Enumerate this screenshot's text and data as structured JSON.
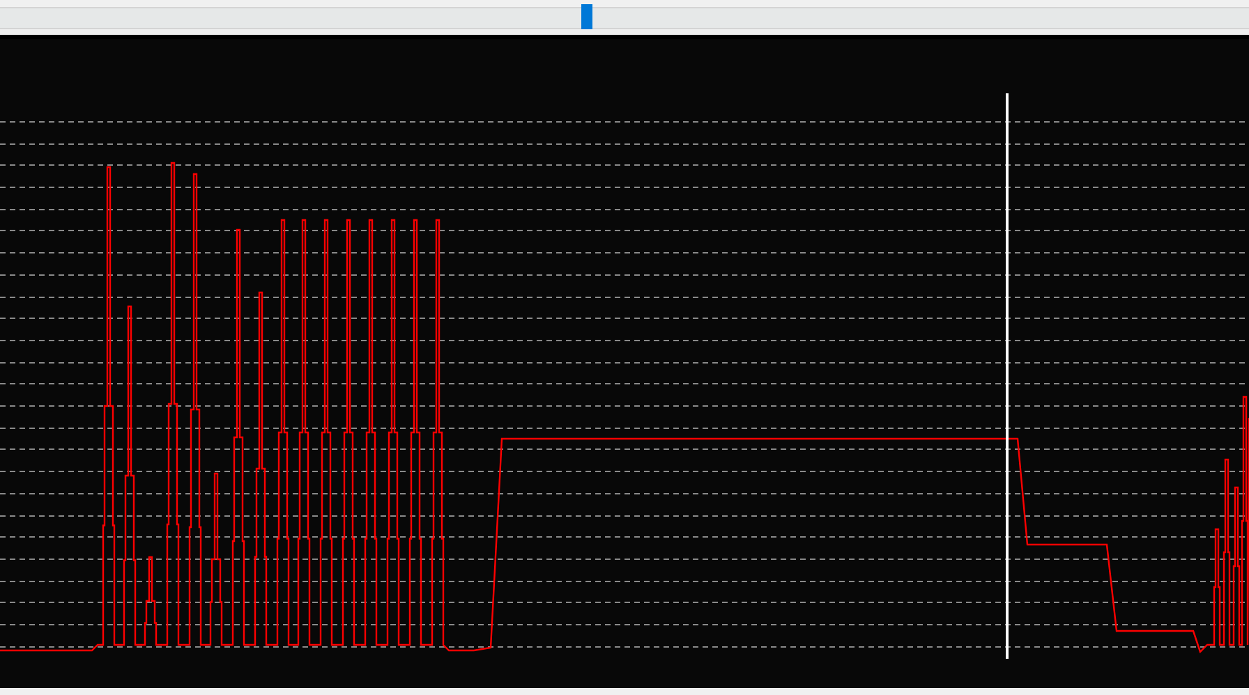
{
  "scroll_bar": {
    "kind": "horizontal"
  },
  "plot": {
    "kind": "waveform",
    "cursor": true
  }
}
